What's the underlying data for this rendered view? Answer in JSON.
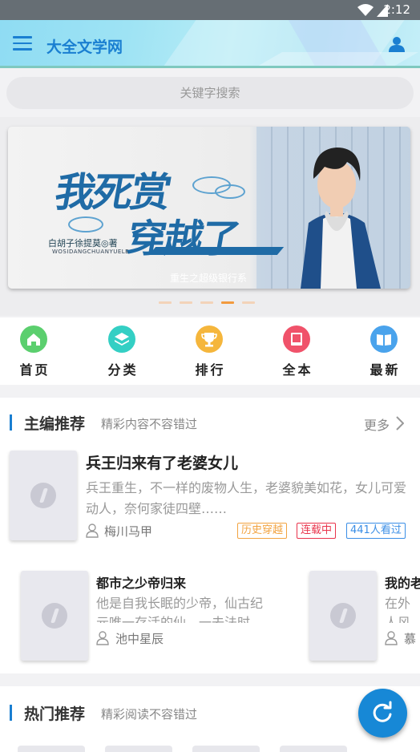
{
  "status_bar": {
    "time": "2:12"
  },
  "app_bar": {
    "title": "大全文学网"
  },
  "search": {
    "placeholder": "关键字搜索"
  },
  "banner": {
    "title_line1": "我死赏",
    "title_line2": "穿越了",
    "author": "白胡子徐提莫◎著",
    "pinyin": "WOSIDANGCHUANYUELE",
    "caption": "重生之超级银行系",
    "slide_count": 5,
    "active_slide": 4
  },
  "categories": [
    {
      "label": "首页",
      "icon": "home-icon",
      "color": "#5bcf6e"
    },
    {
      "label": "分类",
      "icon": "layers-icon",
      "color": "#34cfc4"
    },
    {
      "label": "排行",
      "icon": "trophy-icon",
      "color": "#f5b63c"
    },
    {
      "label": "全本",
      "icon": "book-icon",
      "color": "#f0526a"
    },
    {
      "label": "最新",
      "icon": "open-book-icon",
      "color": "#4aa3ec"
    }
  ],
  "editor_picks": {
    "title": "主编推荐",
    "subtitle": "精彩内容不容错过",
    "more_label": "更多",
    "featured": {
      "title": "兵王归来有了老婆女儿",
      "description": "兵王重生，不一样的废物人生，老婆貌美如花，女儿可爱动人，奈何家徒四壁……",
      "author": "梅川马甲",
      "tags": [
        {
          "text": "历史穿越",
          "color": "#f2a340"
        },
        {
          "text": "连载中",
          "color": "#e9334b"
        },
        {
          "text": "441人看过",
          "color": "#3a8ee6"
        }
      ]
    },
    "books": [
      {
        "title": "都市之少帝归来",
        "description": "他是自我长眠的少帝，仙古纪元唯一存活的仙，一去法时",
        "author": "池中星辰"
      },
      {
        "title": "我的老",
        "description": "在外人风光",
        "author": "慕"
      }
    ]
  },
  "hot_picks": {
    "title": "热门推荐",
    "subtitle": "精彩阅读不容错过"
  },
  "colors": {
    "accent": "#1a7fd1",
    "fab": "#1788d6"
  }
}
